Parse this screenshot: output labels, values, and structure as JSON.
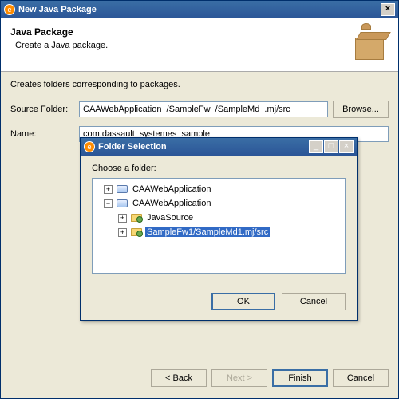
{
  "window": {
    "title": "New Java Package"
  },
  "banner": {
    "heading": "Java Package",
    "sub": "Create a Java package."
  },
  "desc": "Creates folders corresponding to packages.",
  "labels": {
    "sourceFolder": "Source Folder:",
    "name": "Name:"
  },
  "fields": {
    "sourceFolder": "CAAWebApplication  /SampleFw  /SampleMd  .mj/src",
    "name": "com.dassault_systemes_sample"
  },
  "buttons": {
    "browse": "Browse...",
    "back": "< Back",
    "next": "Next >",
    "finish": "Finish",
    "cancel": "Cancel",
    "ok": "OK"
  },
  "dialog": {
    "title": "Folder Selection",
    "prompt": "Choose a folder:",
    "tree": {
      "n1": "CAAWebApplication",
      "n2": "CAAWebApplication",
      "n3": "JavaSource",
      "n4": "SampleFw1/SampleMd1.mj/src"
    }
  }
}
